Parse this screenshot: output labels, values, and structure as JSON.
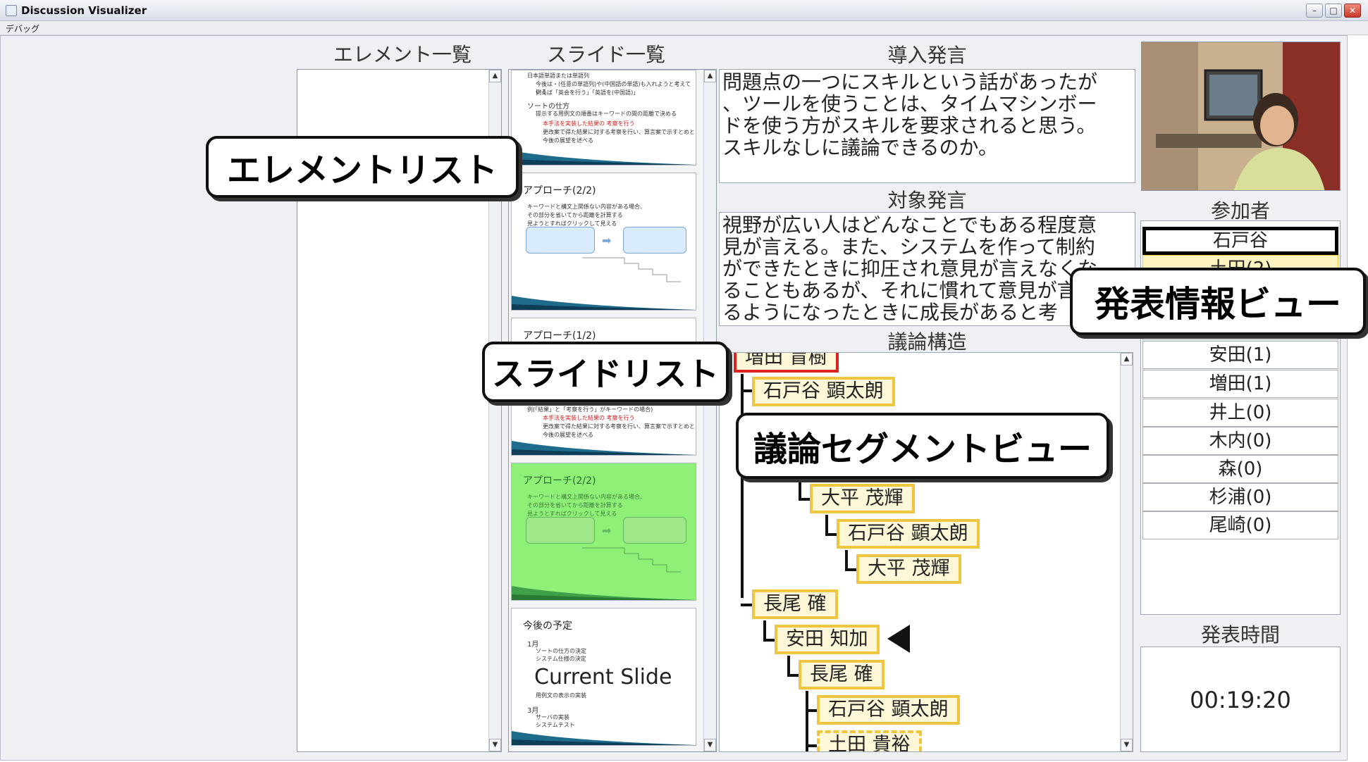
{
  "window": {
    "title": "Discussion Visualizer"
  },
  "menu": {
    "items": [
      "デバッグ"
    ]
  },
  "headings": {
    "elements": "エレメント一覧",
    "slides": "スライド一覧",
    "intro": "導入発言",
    "target": "対象発言",
    "structure": "議論構造",
    "participants": "参加者",
    "time": "発表時間"
  },
  "callouts": {
    "element_list": "エレメントリスト",
    "slide_list": "スライドリスト",
    "presentation_view": "発表情報ビュー",
    "segment_view": "議論セグメントビュー"
  },
  "slides": [
    {
      "title": "",
      "bullets": [
        "日本語単語または単語列",
        "今後は・(任意の単語列)や(中国語の単語)も入れようと考えている",
        "例えば「英会を行う」「英語を(中国語)」",
        "ソートの仕方",
        "提示する用例文の順番はキーワードの間の距離で決める",
        "本手法を実装した結果の 考察を行う",
        "更改案で得た結果に対する考察を行い、算言案で示すとめと",
        "今後の展望を述べる"
      ]
    },
    {
      "title": "アプローチ(2/2)",
      "bullets": [
        "キーワードと構文上関係ない内容がある場合、",
        "その部分を省いてから距離を計算する",
        "見ようとすればクリックして見える"
      ]
    },
    {
      "title": "アプローチ(1/2)",
      "bullets": [
        "例(「結果」と「考察を行う」がキーワードの場合)",
        "本手法を実装した結果の 考察を行う",
        "更改案で得た結果に対する考察を行い、算言案で示すとめと",
        "今後の展望を述べる"
      ]
    },
    {
      "title": "アプローチ(2/2)",
      "bullets": [
        "キーワードと構文上関係ない内容がある場合、",
        "その部分を省いてから距離を計算する",
        "見ようとすればクリックして見える"
      ]
    },
    {
      "title": "今後の予定",
      "bullets": [
        "1月",
        "ソートの仕方の決定",
        "システム仕様の決定",
        "用例文の表示の実装",
        "3月",
        "サーバの実装",
        "システムテスト"
      ]
    }
  ],
  "current_slide_label": "Current Slide",
  "intro_text": [
    "問題点の一つにスキルという話があったが",
    "、ツールを使うことは、タイムマシンボー",
    "ドを使う方がスキルを要求されると思う。",
    "スキルなしに議論できるのか。"
  ],
  "target_text": [
    "視野が広い人はどんなことでもある程度意",
    "見が言える。また、システムを作って制約",
    "ができたときに抑圧され意見が言えなくな",
    "ることもあるが、それに慣れて意見が言え",
    "るようになったときに成長があると考"
  ],
  "participants": [
    "石戸谷",
    "土田(2)",
    "",
    "",
    "安田(1)",
    "増田(1)",
    "井上(0)",
    "木内(0)",
    "森(0)",
    "杉浦(0)",
    "尾崎(0)"
  ],
  "presentation_time": "00:19:20",
  "tree_nodes": [
    "増田 盲樹",
    "石戸谷 顕太朗",
    "大平 茂輝",
    "石戸谷 顕太朗",
    "大平 茂輝",
    "長尾 確",
    "安田 知加",
    "長尾 確",
    "石戸谷 顕太朗",
    "土田 貴裕"
  ],
  "colors": {
    "node_border": "#f0c640",
    "node_fill": "#fff8d8",
    "active_node_border": "#dd2222",
    "current_slide": "#8ff078"
  },
  "icons": {
    "arrow": "pointer-triangle-icon",
    "scroll_up": "scroll-up-icon",
    "scroll_down": "scroll-down-icon"
  }
}
